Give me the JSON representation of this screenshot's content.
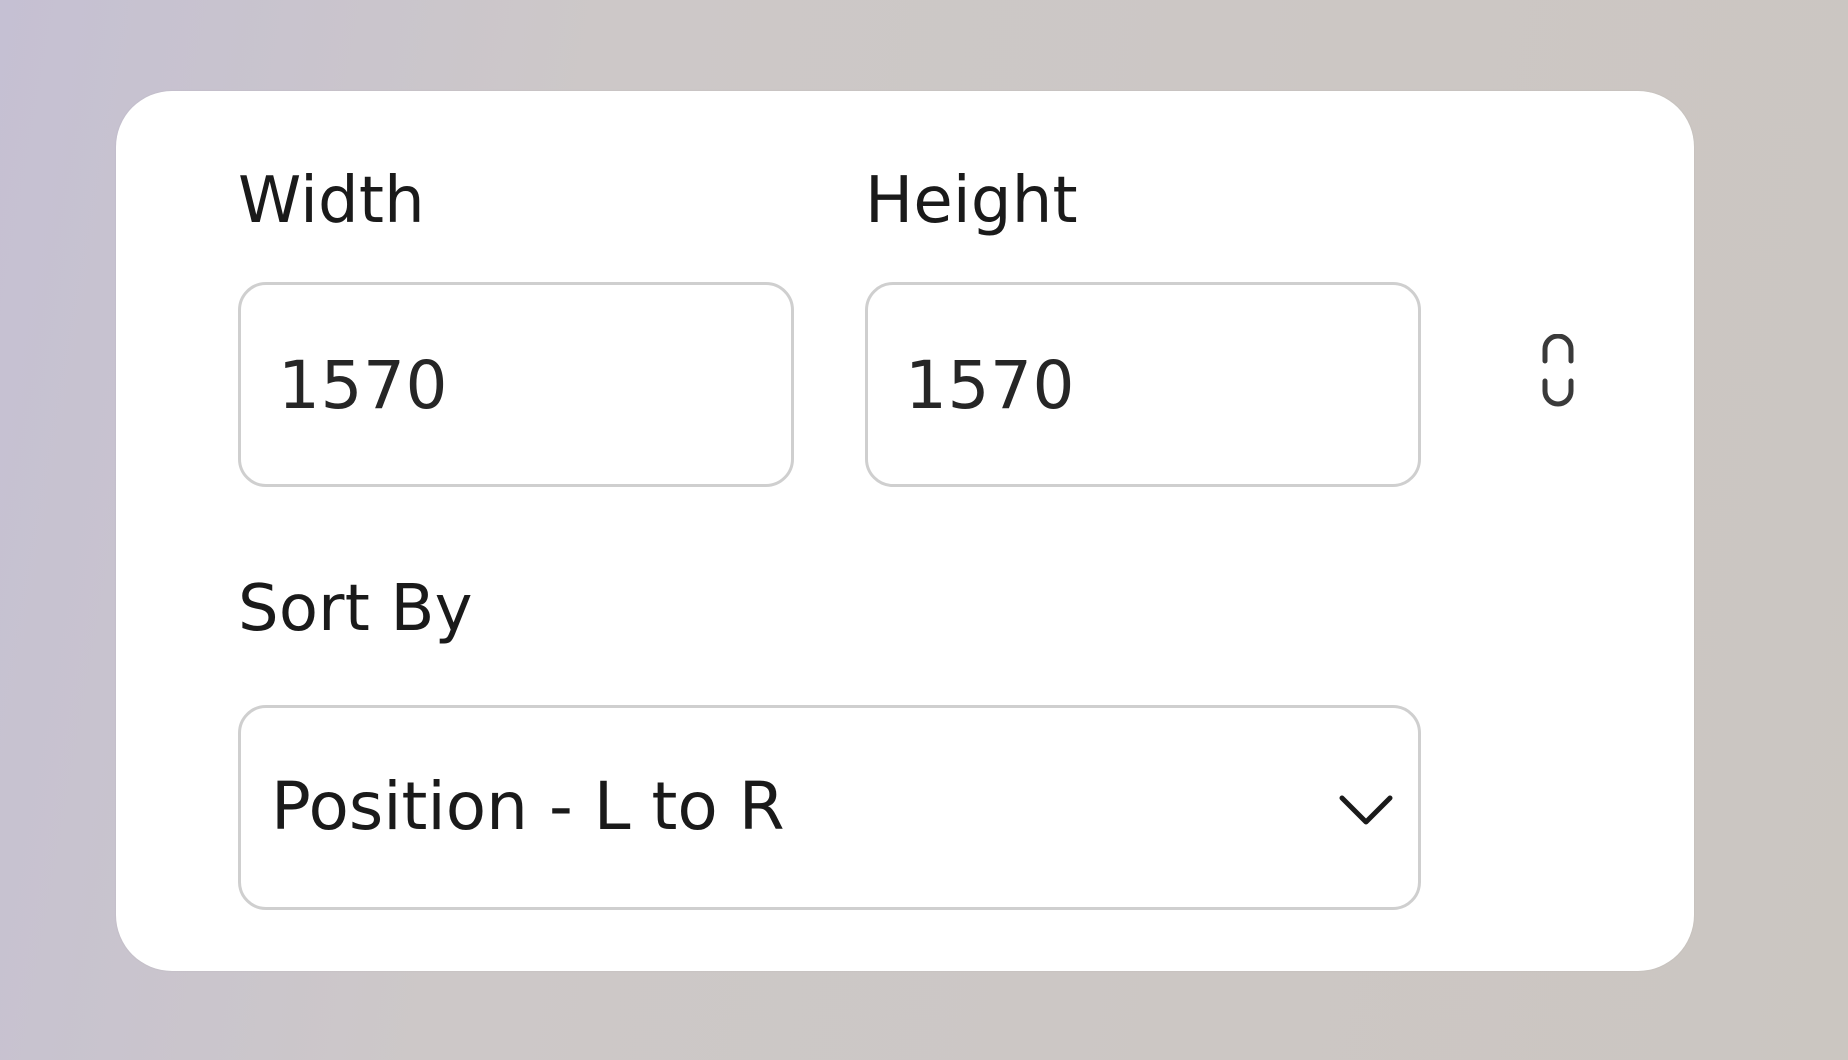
{
  "dimensions": {
    "width_label": "Width",
    "height_label": "Height",
    "width_value": "1570",
    "height_value": "1570",
    "aspect_lock_icon": "unlinked-chain-icon"
  },
  "sort": {
    "label": "Sort By",
    "selected": "Position - L to R",
    "dropdown_icon": "chevron-down-icon"
  }
}
